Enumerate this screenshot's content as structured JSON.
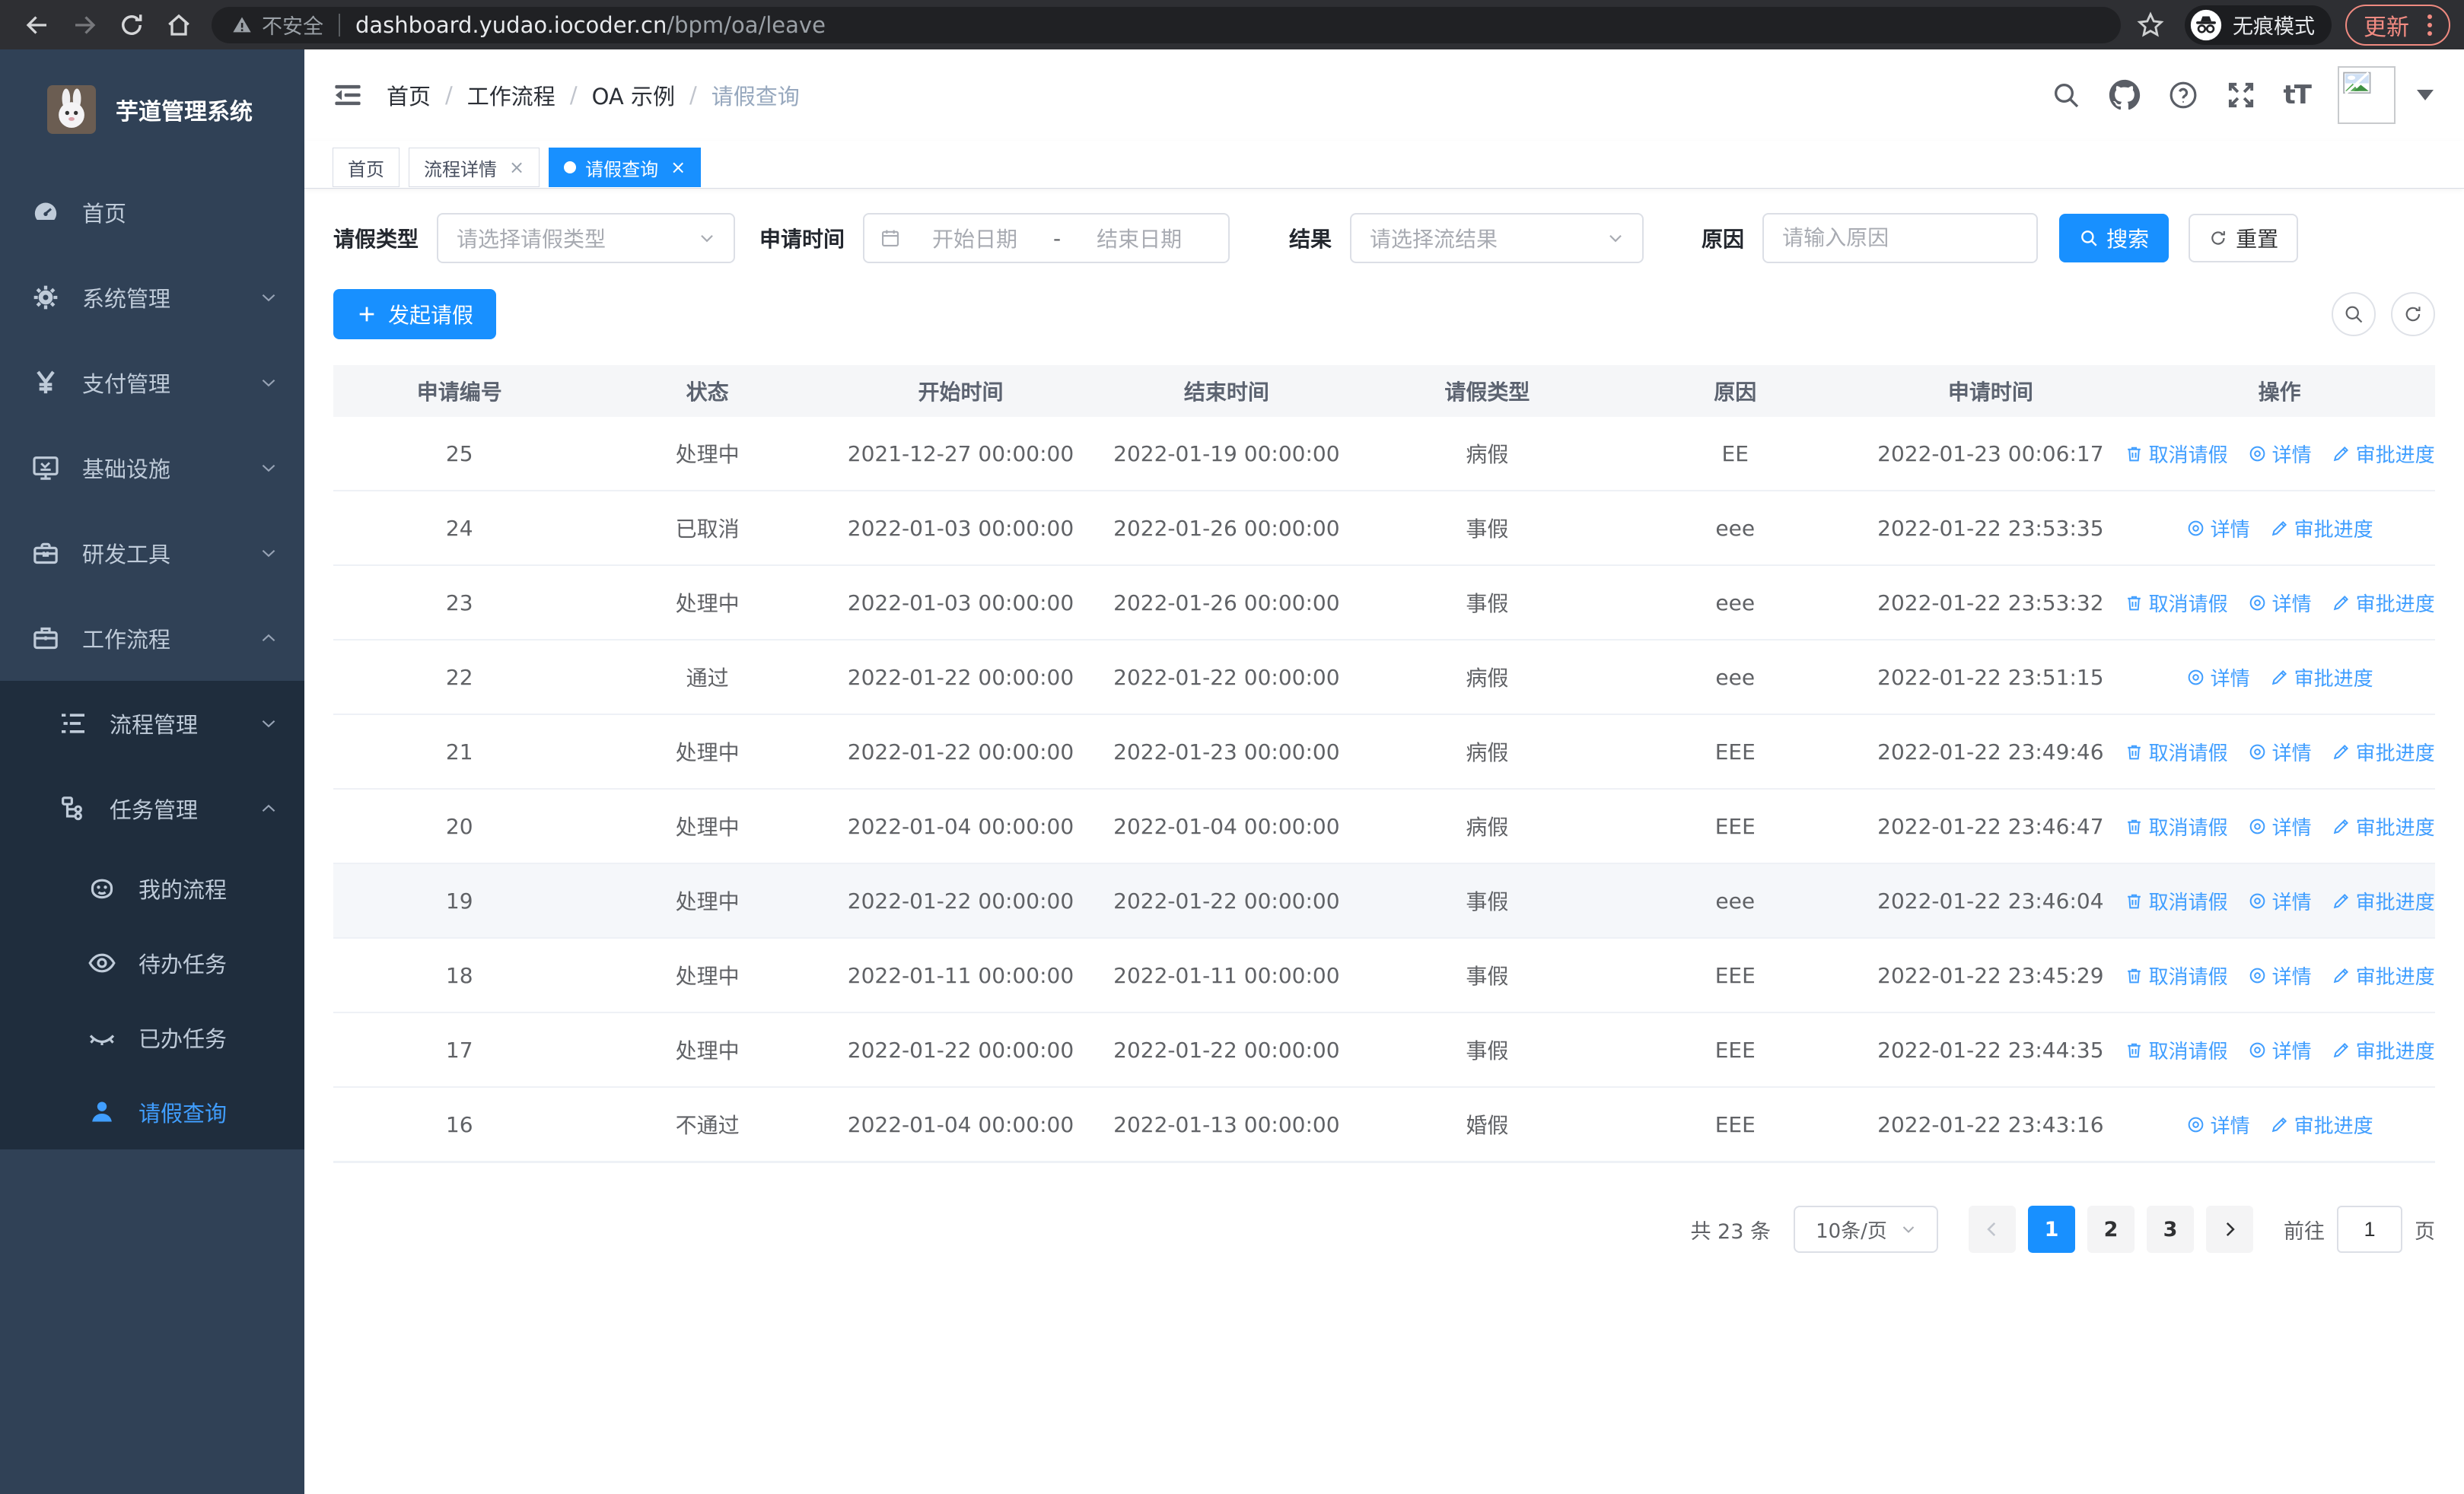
{
  "browser": {
    "security_label": "不安全",
    "url_domain": "dashboard.yudao.iocoder.cn",
    "url_path": "/bpm/oa/leave",
    "incognito_label": "无痕模式",
    "update_label": "更新"
  },
  "sidebar": {
    "app_title": "芋道管理系统",
    "menu": [
      {
        "name": "home",
        "label": "首页",
        "icon": "dashboard-icon",
        "level": 1,
        "arrow": "",
        "group": false,
        "active": false
      },
      {
        "name": "system-management",
        "label": "系统管理",
        "icon": "gear-icon",
        "level": 1,
        "arrow": "down",
        "group": false,
        "active": false
      },
      {
        "name": "payment-management",
        "label": "支付管理",
        "icon": "yen-icon",
        "level": 1,
        "arrow": "down",
        "group": false,
        "active": false
      },
      {
        "name": "infrastructure",
        "label": "基础设施",
        "icon": "monitor-icon",
        "level": 1,
        "arrow": "down",
        "group": false,
        "active": false
      },
      {
        "name": "dev-tools",
        "label": "研发工具",
        "icon": "toolbox-icon",
        "level": 1,
        "arrow": "down",
        "group": false,
        "active": false
      },
      {
        "name": "workflow",
        "label": "工作流程",
        "icon": "briefcase-icon",
        "level": 1,
        "arrow": "up",
        "group": false,
        "active": false
      },
      {
        "name": "process-management",
        "label": "流程管理",
        "icon": "list-icon",
        "level": 2,
        "arrow": "down",
        "group": true,
        "active": false
      },
      {
        "name": "task-management",
        "label": "任务管理",
        "icon": "tree-icon",
        "level": 2,
        "arrow": "up",
        "group": true,
        "active": false
      },
      {
        "name": "my-process",
        "label": "我的流程",
        "icon": "robot-icon",
        "level": 3,
        "arrow": "",
        "group": true,
        "active": false
      },
      {
        "name": "todo-tasks",
        "label": "待办任务",
        "icon": "eye-icon",
        "level": 3,
        "arrow": "",
        "group": true,
        "active": false
      },
      {
        "name": "done-tasks",
        "label": "已办任务",
        "icon": "eye-closed-icon",
        "level": 3,
        "arrow": "",
        "group": true,
        "active": false
      },
      {
        "name": "leave-query",
        "label": "请假查询",
        "icon": "user-icon",
        "level": 3,
        "arrow": "",
        "group": true,
        "active": true
      }
    ]
  },
  "header": {
    "breadcrumb": [
      {
        "label": "首页",
        "current": false
      },
      {
        "label": "工作流程",
        "current": false
      },
      {
        "label": "OA 示例",
        "current": false
      },
      {
        "label": "请假查询",
        "current": true
      }
    ],
    "font_size_icon_text": "tT"
  },
  "tabs": [
    {
      "name": "home",
      "label": "首页",
      "closable": false,
      "active": false
    },
    {
      "name": "process-detail",
      "label": "流程详情",
      "closable": true,
      "active": false
    },
    {
      "name": "leave-query",
      "label": "请假查询",
      "closable": true,
      "active": true
    }
  ],
  "filters": {
    "type_label": "请假类型",
    "type_placeholder": "请选择请假类型",
    "time_label": "申请时间",
    "time_start_placeholder": "开始日期",
    "time_separator": "-",
    "time_end_placeholder": "结束日期",
    "result_label": "结果",
    "result_placeholder": "请选择流结果",
    "reason_label": "原因",
    "reason_placeholder": "请输入原因",
    "search_label": "搜索",
    "reset_label": "重置"
  },
  "toolbar": {
    "create_label": "发起请假"
  },
  "table": {
    "columns": [
      "申请编号",
      "状态",
      "开始时间",
      "结束时间",
      "请假类型",
      "原因",
      "申请时间",
      "操作"
    ],
    "action_labels": {
      "cancel": "取消请假",
      "detail": "详情",
      "progress": "审批进度"
    },
    "rows": [
      {
        "id": "25",
        "status": "处理中",
        "start_time": "2021-12-27 00:00:00",
        "end_time": "2022-01-19 00:00:00",
        "leave_type": "病假",
        "reason": "EE",
        "apply_time": "2022-01-23 00:06:17",
        "actions": [
          "cancel",
          "detail",
          "progress"
        ],
        "highlighted": false
      },
      {
        "id": "24",
        "status": "已取消",
        "start_time": "2022-01-03 00:00:00",
        "end_time": "2022-01-26 00:00:00",
        "leave_type": "事假",
        "reason": "eee",
        "apply_time": "2022-01-22 23:53:35",
        "actions": [
          "detail",
          "progress"
        ],
        "highlighted": false
      },
      {
        "id": "23",
        "status": "处理中",
        "start_time": "2022-01-03 00:00:00",
        "end_time": "2022-01-26 00:00:00",
        "leave_type": "事假",
        "reason": "eee",
        "apply_time": "2022-01-22 23:53:32",
        "actions": [
          "cancel",
          "detail",
          "progress"
        ],
        "highlighted": false
      },
      {
        "id": "22",
        "status": "通过",
        "start_time": "2022-01-22 00:00:00",
        "end_time": "2022-01-22 00:00:00",
        "leave_type": "病假",
        "reason": "eee",
        "apply_time": "2022-01-22 23:51:15",
        "actions": [
          "detail",
          "progress"
        ],
        "highlighted": false
      },
      {
        "id": "21",
        "status": "处理中",
        "start_time": "2022-01-22 00:00:00",
        "end_time": "2022-01-23 00:00:00",
        "leave_type": "病假",
        "reason": "EEE",
        "apply_time": "2022-01-22 23:49:46",
        "actions": [
          "cancel",
          "detail",
          "progress"
        ],
        "highlighted": false
      },
      {
        "id": "20",
        "status": "处理中",
        "start_time": "2022-01-04 00:00:00",
        "end_time": "2022-01-04 00:00:00",
        "leave_type": "病假",
        "reason": "EEE",
        "apply_time": "2022-01-22 23:46:47",
        "actions": [
          "cancel",
          "detail",
          "progress"
        ],
        "highlighted": false
      },
      {
        "id": "19",
        "status": "处理中",
        "start_time": "2022-01-22 00:00:00",
        "end_time": "2022-01-22 00:00:00",
        "leave_type": "事假",
        "reason": "eee",
        "apply_time": "2022-01-22 23:46:04",
        "actions": [
          "cancel",
          "detail",
          "progress"
        ],
        "highlighted": true
      },
      {
        "id": "18",
        "status": "处理中",
        "start_time": "2022-01-11 00:00:00",
        "end_time": "2022-01-11 00:00:00",
        "leave_type": "事假",
        "reason": "EEE",
        "apply_time": "2022-01-22 23:45:29",
        "actions": [
          "cancel",
          "detail",
          "progress"
        ],
        "highlighted": false
      },
      {
        "id": "17",
        "status": "处理中",
        "start_time": "2022-01-22 00:00:00",
        "end_time": "2022-01-22 00:00:00",
        "leave_type": "事假",
        "reason": "EEE",
        "apply_time": "2022-01-22 23:44:35",
        "actions": [
          "cancel",
          "detail",
          "progress"
        ],
        "highlighted": false
      },
      {
        "id": "16",
        "status": "不通过",
        "start_time": "2022-01-04 00:00:00",
        "end_time": "2022-01-13 00:00:00",
        "leave_type": "婚假",
        "reason": "EEE",
        "apply_time": "2022-01-22 23:43:16",
        "actions": [
          "detail",
          "progress"
        ],
        "highlighted": false
      }
    ]
  },
  "pagination": {
    "total_label": "共 23 条",
    "page_size_label": "10条/页",
    "pages": [
      "1",
      "2",
      "3"
    ],
    "active_page": "1",
    "goto_label": "前往",
    "goto_value": "1",
    "goto_suffix": "页"
  },
  "colors": {
    "primary": "#1890ff",
    "link": "#409eff",
    "sidebar_bg": "#304156",
    "submenu_bg": "#1f2d3d",
    "update_accent": "#f28b82"
  }
}
